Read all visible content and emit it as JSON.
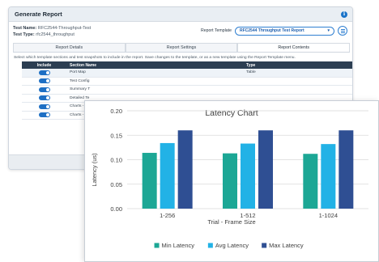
{
  "dialog": {
    "title": "Generate Report",
    "info_icon_glyph": "i",
    "test_name_label": "Test Name:",
    "test_name_value": "RFC2544-Throughput-Test",
    "test_type_label": "Test Type:",
    "test_type_value": "rfc2544_throughput",
    "template_label": "Report Template",
    "template_value": "RFC2544 Throughput Test Report",
    "tabs": [
      {
        "label": "Report Details"
      },
      {
        "label": "Report Settings"
      },
      {
        "label": "Report Contents"
      }
    ],
    "hint": "Select which template sections and test snapshots to include in the report. Save changes to the template, or as a new template using the Report Template menu.",
    "columns": {
      "include": "Include",
      "name": "Section Name",
      "type": "Type"
    },
    "rows": [
      {
        "name": "Port Map",
        "type": "Table"
      },
      {
        "name": "Test Config",
        "type": ""
      },
      {
        "name": "Summary T",
        "type": ""
      },
      {
        "name": "Detailed Te",
        "type": ""
      },
      {
        "name": "Charts - La",
        "type": ""
      },
      {
        "name": "Charts - Th",
        "type": ""
      }
    ]
  },
  "chart_data": {
    "type": "bar",
    "title": "Latency Chart",
    "xlabel": "Trial - Frame Size",
    "ylabel": "Latency (us)",
    "ylim": [
      0,
      0.2
    ],
    "yticks": [
      "0.00",
      "0.05",
      "0.10",
      "0.15",
      "0.20"
    ],
    "categories": [
      "1-256",
      "1-512",
      "1-1024"
    ],
    "series": [
      {
        "name": "Min Latency",
        "values": [
          0.114,
          0.113,
          0.112
        ],
        "color": "#1ca795"
      },
      {
        "name": "Avg Latency",
        "values": [
          0.134,
          0.133,
          0.132
        ],
        "color": "#22b2e6"
      },
      {
        "name": "Max Latency",
        "values": [
          0.16,
          0.16,
          0.16
        ],
        "color": "#2f4f93"
      }
    ],
    "legend_position": "bottom",
    "grid": true
  }
}
